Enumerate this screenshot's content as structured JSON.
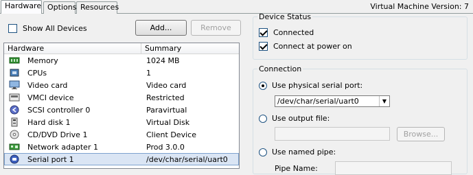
{
  "tabs": [
    {
      "label": "Hardware"
    },
    {
      "label": "Options"
    },
    {
      "label": "Resources"
    }
  ],
  "vm_version": "Virtual Machine Version: 7",
  "left": {
    "show_all_devices": "Show All Devices",
    "add_button": "Add...",
    "remove_button": "Remove",
    "columns": {
      "hardware": "Hardware",
      "summary": "Summary"
    },
    "rows": [
      {
        "name": "Memory",
        "summary": "1024 MB"
      },
      {
        "name": "CPUs",
        "summary": "1"
      },
      {
        "name": "Video card",
        "summary": "Video card"
      },
      {
        "name": "VMCI device",
        "summary": "Restricted"
      },
      {
        "name": "SCSI controller 0",
        "summary": "Paravirtual"
      },
      {
        "name": "Hard disk 1",
        "summary": "Virtual Disk"
      },
      {
        "name": "CD/DVD Drive 1",
        "summary": "Client Device"
      },
      {
        "name": "Network adapter 1",
        "summary": "Prod 3.0.0"
      },
      {
        "name": "Serial port 1",
        "summary": "/dev/char/serial/uart0"
      }
    ]
  },
  "device_status": {
    "title": "Device Status",
    "connected": "Connected",
    "connect_at_power_on": "Connect at power on"
  },
  "connection": {
    "title": "Connection",
    "use_physical": "Use physical serial port:",
    "physical_value": "/dev/char/serial/uart0",
    "use_output_file": "Use output file:",
    "browse": "Browse...",
    "use_named_pipe": "Use named pipe:",
    "pipe_name": "Pipe Name:"
  }
}
